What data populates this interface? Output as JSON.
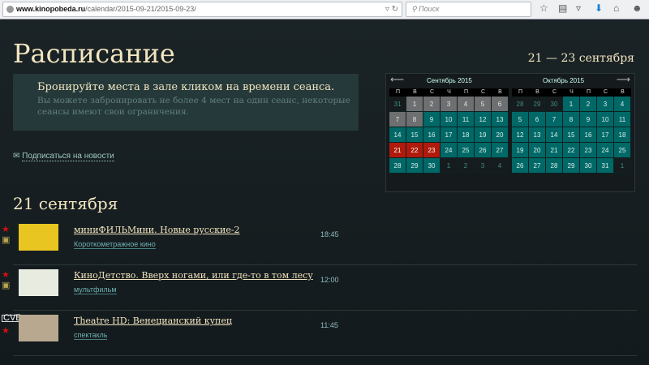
{
  "browser": {
    "url_domain": "www.kinopobeda.ru",
    "url_path": "/calendar/2015-09-21/2015-09-23/",
    "search_placeholder": "Поиск"
  },
  "page": {
    "title": "Расписание",
    "date_range": "21 — 23 сентября",
    "info_title": "Бронируйте места в зале кликом на времени сеанса.",
    "info_text": "Вы можете забронировать не более 4 мест на один сеанс, некоторые сеансы имеют свои ограничения.",
    "subscribe": "Подписаться на новости",
    "day_heading": "21 сентября"
  },
  "calendar": {
    "weekdays": [
      "П",
      "В",
      "С",
      "Ч",
      "П",
      "С",
      "В"
    ],
    "months": [
      {
        "name": "Сентябрь 2015",
        "days": [
          [
            "31",
            "other"
          ],
          [
            "1",
            "past"
          ],
          [
            "2",
            "past"
          ],
          [
            "3",
            "past"
          ],
          [
            "4",
            "past"
          ],
          [
            "5",
            "past"
          ],
          [
            "6",
            "past"
          ],
          [
            "7",
            "past"
          ],
          [
            "8",
            "past"
          ],
          [
            "9",
            "avail"
          ],
          [
            "10",
            "avail"
          ],
          [
            "11",
            "avail"
          ],
          [
            "12",
            "avail"
          ],
          [
            "13",
            "avail"
          ],
          [
            "14",
            "avail"
          ],
          [
            "15",
            "avail"
          ],
          [
            "16",
            "avail"
          ],
          [
            "17",
            "avail"
          ],
          [
            "18",
            "avail"
          ],
          [
            "19",
            "avail"
          ],
          [
            "20",
            "avail"
          ],
          [
            "21",
            "sel"
          ],
          [
            "22",
            "sel"
          ],
          [
            "23",
            "sel"
          ],
          [
            "24",
            "avail"
          ],
          [
            "25",
            "avail"
          ],
          [
            "26",
            "avail"
          ],
          [
            "27",
            "avail"
          ],
          [
            "28",
            "avail"
          ],
          [
            "29",
            "avail"
          ],
          [
            "30",
            "avail"
          ],
          [
            "1",
            "other"
          ],
          [
            "2",
            "other"
          ],
          [
            "3",
            "other"
          ],
          [
            "4",
            "other"
          ]
        ]
      },
      {
        "name": "Октябрь 2015",
        "days": [
          [
            "28",
            "other"
          ],
          [
            "29",
            "other"
          ],
          [
            "30",
            "other"
          ],
          [
            "1",
            "avail"
          ],
          [
            "2",
            "avail"
          ],
          [
            "3",
            "avail"
          ],
          [
            "4",
            "avail"
          ],
          [
            "5",
            "avail"
          ],
          [
            "6",
            "avail"
          ],
          [
            "7",
            "avail"
          ],
          [
            "8",
            "avail"
          ],
          [
            "9",
            "avail"
          ],
          [
            "10",
            "avail"
          ],
          [
            "11",
            "avail"
          ],
          [
            "12",
            "avail"
          ],
          [
            "13",
            "avail"
          ],
          [
            "14",
            "avail"
          ],
          [
            "15",
            "avail"
          ],
          [
            "16",
            "avail"
          ],
          [
            "17",
            "avail"
          ],
          [
            "18",
            "avail"
          ],
          [
            "19",
            "avail"
          ],
          [
            "20",
            "avail"
          ],
          [
            "21",
            "avail"
          ],
          [
            "22",
            "avail"
          ],
          [
            "23",
            "avail"
          ],
          [
            "24",
            "avail"
          ],
          [
            "25",
            "avail"
          ],
          [
            "26",
            "avail"
          ],
          [
            "27",
            "avail"
          ],
          [
            "28",
            "avail"
          ],
          [
            "29",
            "avail"
          ],
          [
            "30",
            "avail"
          ],
          [
            "31",
            "avail"
          ],
          [
            "1",
            "other"
          ]
        ]
      }
    ],
    "colors": {
      "past": "#6d6f70",
      "available": "#006866",
      "selected": "#b01a0c"
    }
  },
  "events": [
    {
      "title": "миниФИЛЬМини. Новые русские-2",
      "genre": "Короткометражное кино",
      "time": "18:45",
      "icons": [
        "star-icon",
        "camera-icon"
      ],
      "thumb_color": "#e8c520"
    },
    {
      "title": "КиноДетство. Вверх ногами, или где-то в том лесу",
      "genre": "мультфильм",
      "time": "12:00",
      "icons": [
        "star-icon",
        "camera-icon"
      ],
      "thumb_color": "#e8ece0"
    },
    {
      "title": "Theatre HD: Венецианский купец",
      "genre": "спектакль",
      "time": "11:45",
      "icons": [
        "hd-icon",
        "star-icon"
      ],
      "hd_label": "CVБ",
      "thumb_color": "#b8a890"
    }
  ]
}
